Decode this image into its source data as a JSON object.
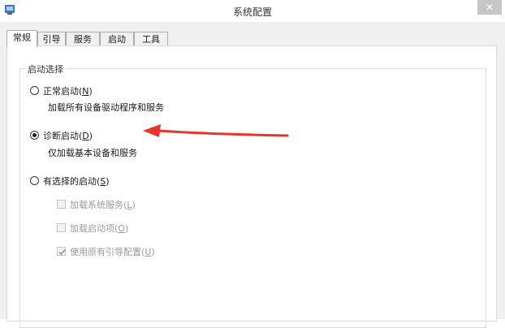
{
  "window": {
    "title": "系统配置",
    "close_glyph": "✕"
  },
  "tabs": [
    {
      "label": "常规",
      "active": true
    },
    {
      "label": "引导"
    },
    {
      "label": "服务"
    },
    {
      "label": "启动"
    },
    {
      "label": "工具"
    }
  ],
  "startup_selection": {
    "group_title": "启动选择",
    "options": [
      {
        "label": "正常启动(",
        "key": "N",
        "suffix": ")",
        "description": "加载所有设备驱动程序和服务",
        "selected": false
      },
      {
        "label": "诊断启动(",
        "key": "D",
        "suffix": ")",
        "description": "仅加载基本设备和服务",
        "selected": true
      },
      {
        "label": "有选择的启动(",
        "key": "S",
        "suffix": ")",
        "selected": false
      }
    ],
    "sub_options": [
      {
        "label": "加载系统服务(",
        "key": "L",
        "suffix": ")",
        "checked": false,
        "enabled": false
      },
      {
        "label": "加载启动项(",
        "key": "O",
        "suffix": ")",
        "checked": false,
        "enabled": false
      },
      {
        "label": "使用原有引导配置(",
        "key": "U",
        "suffix": ")",
        "checked": true,
        "enabled": false
      }
    ]
  },
  "annotation": {
    "color": "#e8352b"
  }
}
